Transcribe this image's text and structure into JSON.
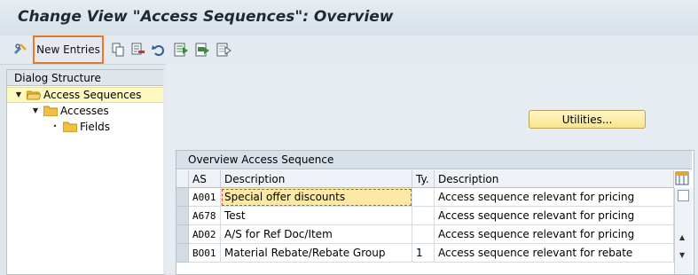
{
  "window": {
    "title": "Change View \"Access Sequences\": Overview"
  },
  "toolbar": {
    "new_entries_label": "New Entries",
    "icons": [
      "display-change-icon",
      "copy-icon",
      "delete-icon",
      "undo-icon",
      "select-all-icon",
      "select-block-icon",
      "deselect-all-icon"
    ]
  },
  "dialog_structure": {
    "header": "Dialog Structure",
    "items": [
      {
        "label": "Access Sequences",
        "selected": true,
        "expanded": true
      },
      {
        "label": "Accesses",
        "selected": false,
        "expanded": true
      },
      {
        "label": "Fields",
        "selected": false,
        "expanded": false
      }
    ]
  },
  "utilities_label": "Utilities...",
  "table": {
    "caption": "Overview Access Sequence",
    "columns": [
      "AS",
      "Description",
      "Ty.",
      "Description"
    ],
    "rows": [
      {
        "as": "A001",
        "description": "Special offer discounts",
        "ty": "",
        "type_description": "Access sequence relevant for pricing"
      },
      {
        "as": "A678",
        "description": "Test",
        "ty": "",
        "type_description": "Access sequence relevant for pricing"
      },
      {
        "as": "AD02",
        "description": "A/S for Ref Doc/Item",
        "ty": "",
        "type_description": "Access sequence relevant for pricing"
      },
      {
        "as": "BO01",
        "description": "Material Rebate/Rebate Group",
        "ty": "1",
        "type_description": "Access sequence relevant for rebate"
      }
    ]
  },
  "colors": {
    "highlight_button_border": "#e8782e",
    "selected_row": "#fdf7c0",
    "focus_cell": "#fde9a6"
  }
}
